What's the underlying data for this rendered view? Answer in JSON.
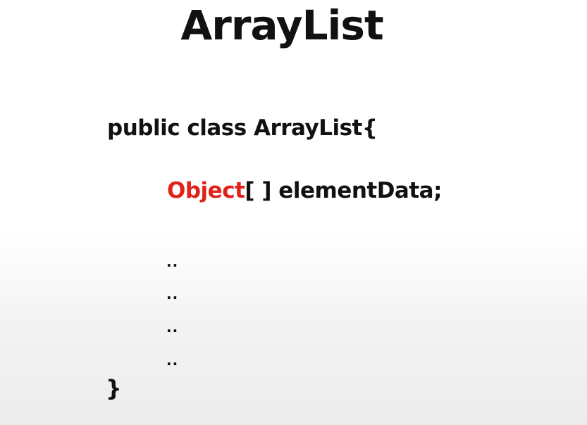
{
  "slide": {
    "title": "ArrayList",
    "class_declaration": "public class ArrayList{",
    "field": {
      "type": "Object",
      "rest": "[ ] elementData;"
    },
    "ellipsis_rows": [
      "..",
      "..",
      "..",
      ".."
    ],
    "closing_brace": "}",
    "highlight_color": "#e0221a"
  }
}
